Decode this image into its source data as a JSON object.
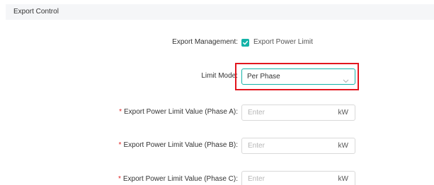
{
  "section": {
    "title": "Export Control"
  },
  "export_management": {
    "label": "Export Management:",
    "checkbox_label": "Export Power Limit",
    "checked": true
  },
  "limit_mode": {
    "label": "Limit Mode:",
    "value": "Per Phase",
    "highlighted": true
  },
  "fields": [
    {
      "required_mark": "*",
      "label": "Export Power Limit Value (Phase A):",
      "placeholder": "Enter",
      "unit": "kW"
    },
    {
      "required_mark": "*",
      "label": "Export Power Limit Value (Phase B):",
      "placeholder": "Enter",
      "unit": "kW"
    },
    {
      "required_mark": "*",
      "label": "Export Power Limit Value (Phase C):",
      "placeholder": "Enter",
      "unit": "kW"
    }
  ],
  "colors": {
    "accent": "#14b3a8",
    "highlight": "#e2161e",
    "required": "#e02020",
    "header_bg": "#f5f6f8"
  }
}
